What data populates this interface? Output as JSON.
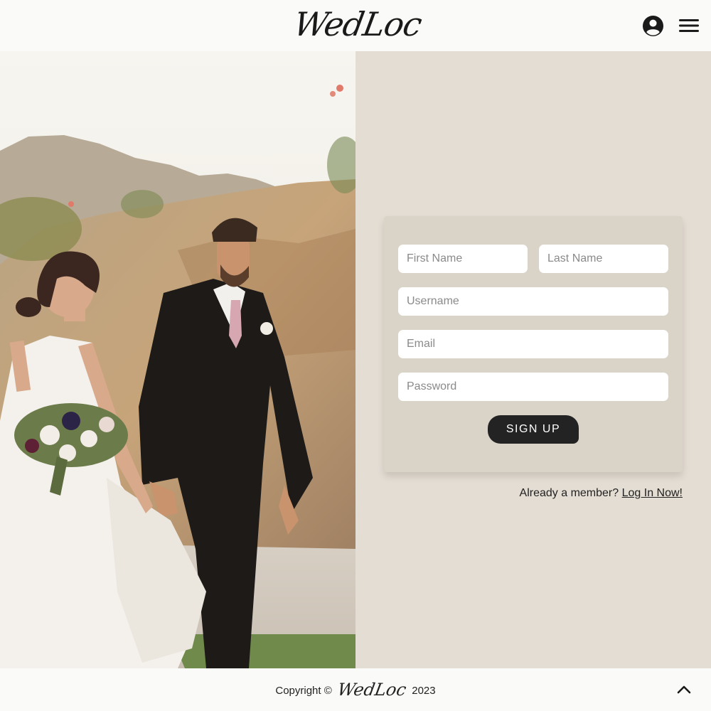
{
  "header": {
    "logo_text": "WedLoc",
    "account_icon": "user-circle-icon",
    "menu_icon": "hamburger-menu-icon"
  },
  "hero": {
    "image": "bride-and-groom-walking-photo"
  },
  "form": {
    "first_name_placeholder": "First Name",
    "last_name_placeholder": "Last Name",
    "username_placeholder": "Username",
    "email_placeholder": "Email",
    "password_placeholder": "Password",
    "signup_label": "SIGN UP",
    "member_prompt": "Already a member?",
    "login_link": "Log In Now!"
  },
  "footer": {
    "copyright_prefix": "Copyright ©",
    "logo_text": "WedLoc",
    "year": "2023",
    "scroll_top_icon": "chevron-up-icon"
  },
  "colors": {
    "panel_bg": "#e4ddd3",
    "card_bg": "#dad3c8",
    "button_bg": "#232323",
    "header_bg": "#fafaf8"
  }
}
